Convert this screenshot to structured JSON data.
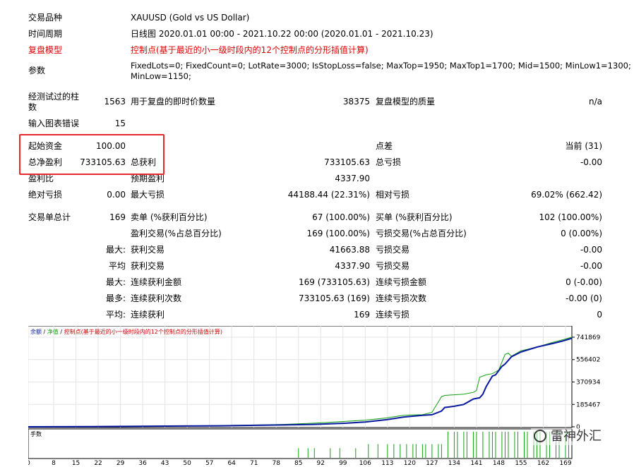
{
  "report": {
    "symbol": {
      "label": "交易品种",
      "value": "XAUUSD (Gold vs US Dollar)"
    },
    "period": {
      "label": "时间周期",
      "value": "日线图 2020.01.01 00:00 - 2021.10.22 00:00 (2020.01.01 - 2021.10.23)"
    },
    "model": {
      "label": "复盘模型",
      "value": "控制点(基于最近的小一级时段内的12个控制点的分形插值计算)"
    },
    "params": {
      "label": "参数",
      "value_line1": "FixedLots=0; FixedCount=0; LotRate=3000; IsStopLoss=false; MaxTop=1950; MaxTop1=1700; Mid=1500; MinLow1=1300;",
      "value_line2": "MinLow=1150;"
    },
    "bars": {
      "label_line1": "经测试过的柱",
      "label_line2": "数",
      "value": "1563"
    },
    "ticks": {
      "label": "用于复盘的即时价数量",
      "value": "38375"
    },
    "quality": {
      "label": "复盘模型的质量",
      "value": "n/a"
    },
    "mismatch": {
      "label": "输入图表错误",
      "value": "15"
    },
    "initial_deposit": {
      "label": "起始资金",
      "value": "100.00"
    },
    "spread": {
      "label": "点差",
      "value": "当前 (31)"
    },
    "net_profit": {
      "label": "总净盈利",
      "value": "733105.63"
    },
    "gross_profit": {
      "label": "总获利",
      "value": "733105.63"
    },
    "gross_loss": {
      "label": "总亏损",
      "value": "-0.00"
    },
    "profit_factor": {
      "label": "盈利比"
    },
    "expected_payoff": {
      "label": "预期盈利",
      "value": "4337.90"
    },
    "abs_drawdown": {
      "label": "绝对亏损",
      "value": "0.00"
    },
    "max_drawdown": {
      "label": "最大亏损",
      "value": "44188.44 (22.31%)"
    },
    "rel_drawdown": {
      "label": "相对亏损",
      "value": "69.02% (662.42)"
    },
    "total_trades": {
      "label": "交易单总计",
      "value": "169"
    },
    "short_positions": {
      "label": "卖单 (%获利百分比)",
      "value": "67 (100.00%)"
    },
    "long_positions": {
      "label": "买单 (%获利百分比)",
      "value": "102 (100.00%)"
    },
    "profit_trades": {
      "label": "盈利交易(%占总百分比)",
      "value": "169 (100.00%)"
    },
    "loss_trades": {
      "label": "亏损交易(%占总百分比)",
      "value": "0 (0.00%)"
    },
    "largest": {
      "prefix": "最大:",
      "profit_label": "获利交易",
      "profit_value": "41663.88",
      "loss_label": "亏损交易",
      "loss_value": "-0.00"
    },
    "average": {
      "prefix": "平均",
      "profit_label": "获利交易",
      "profit_value": "4337.90",
      "loss_label": "亏损交易",
      "loss_value": "-0.00"
    },
    "max_consecutive": {
      "prefix": "最大:",
      "profit_label": "连续获利金额",
      "profit_value": "169 (733105.63)",
      "loss_label": "连续亏损金额",
      "loss_value": "0 (-0.00)"
    },
    "max_consecutive_count": {
      "prefix": "最多:",
      "profit_label": "连续获利次数",
      "profit_value": "733105.63 (169)",
      "loss_label": "连续亏损次数",
      "loss_value": "-0.00 (0)"
    },
    "avg_consecutive": {
      "prefix": "平均:",
      "profit_label": "连续获利",
      "profit_value": "169",
      "loss_label": "连续亏损",
      "loss_value": "0"
    }
  },
  "chart_legend": {
    "balance": "余额",
    "sep1": " / ",
    "equity": "净值",
    "sep2": " / ",
    "model": "控制点(基于最近的小一级时段内的12个控制点的分形插值计算)"
  },
  "lots_label": "手数",
  "watermark": "雷神外汇",
  "chart_data": {
    "type": "line",
    "y_ticks": [
      "741869",
      "556402",
      "370934",
      "185467",
      "0"
    ],
    "ylim": [
      0,
      741869
    ],
    "x_ticks": [
      "0",
      "8",
      "15",
      "22",
      "29",
      "36",
      "43",
      "50",
      "57",
      "64",
      "71",
      "78",
      "85",
      "92",
      "99",
      "106",
      "113",
      "120",
      "127",
      "134",
      "141",
      "148",
      "155",
      "162",
      "169"
    ],
    "xlim": [
      0,
      171
    ],
    "series": [
      {
        "name": "余额",
        "color": "#0a1aa0",
        "x": [
          0,
          20,
          40,
          60,
          80,
          90,
          100,
          106,
          113,
          118,
          120,
          124,
          127,
          130,
          131,
          134,
          137,
          140,
          142,
          143,
          144,
          146,
          147,
          149,
          150,
          152,
          155,
          160,
          165,
          168,
          171
        ],
        "y": [
          100,
          2000,
          5000,
          8000,
          15000,
          20000,
          30000,
          40000,
          60000,
          80000,
          85000,
          95000,
          100000,
          130000,
          160000,
          170000,
          185000,
          230000,
          240000,
          270000,
          330000,
          420000,
          430000,
          500000,
          520000,
          580000,
          620000,
          660000,
          690000,
          710000,
          733106
        ]
      },
      {
        "name": "净值",
        "color": "#10a010",
        "x": [
          0,
          20,
          40,
          60,
          80,
          90,
          100,
          106,
          113,
          118,
          120,
          124,
          127,
          130,
          131,
          134,
          137,
          140,
          141,
          142,
          144,
          146,
          148,
          150,
          151,
          152,
          155,
          160,
          165,
          168,
          171
        ],
        "y": [
          100,
          2500,
          6000,
          10000,
          20000,
          30000,
          45000,
          55000,
          75000,
          95000,
          98000,
          100000,
          120000,
          250000,
          260000,
          265000,
          270000,
          285000,
          300000,
          410000,
          430000,
          440000,
          470000,
          600000,
          610000,
          585000,
          630000,
          660000,
          700000,
          720000,
          741869
        ]
      }
    ],
    "lots": {
      "color": "#10a010",
      "bars": [
        [
          85,
          0.35
        ],
        [
          88,
          0.35
        ],
        [
          90,
          0.35
        ],
        [
          95,
          0.35
        ],
        [
          98,
          0.35
        ],
        [
          103,
          0.35
        ],
        [
          107,
          0.5
        ],
        [
          110,
          0.5
        ],
        [
          113,
          0.5
        ],
        [
          115,
          0.5
        ],
        [
          117,
          0.5
        ],
        [
          119,
          0.5
        ],
        [
          121,
          0.5
        ],
        [
          122,
          0.5
        ],
        [
          124,
          0.5
        ],
        [
          125,
          0.5
        ],
        [
          127,
          0.5
        ],
        [
          129,
          0.5
        ],
        [
          130,
          0.5
        ],
        [
          132,
          0.95
        ],
        [
          134,
          0.95
        ],
        [
          135,
          0.95
        ],
        [
          137,
          0.95
        ],
        [
          138,
          0.95
        ],
        [
          140,
          0.95
        ],
        [
          141,
          0.95
        ],
        [
          143,
          0.95
        ],
        [
          145,
          0.95
        ],
        [
          146,
          0.95
        ],
        [
          147,
          0.95
        ],
        [
          149,
          0.95
        ],
        [
          150,
          0.95
        ],
        [
          151,
          0.95
        ],
        [
          153,
          0.95
        ],
        [
          154,
          0.95
        ],
        [
          156,
          0.95
        ],
        [
          157,
          0.95
        ],
        [
          159,
          0.95
        ],
        [
          160,
          0.95
        ],
        [
          161,
          0.95
        ],
        [
          163,
          0.95
        ],
        [
          164,
          0.95
        ],
        [
          166,
          0.95
        ],
        [
          167,
          0.95
        ],
        [
          169,
          0.95
        ],
        [
          170,
          0.95
        ]
      ]
    }
  }
}
